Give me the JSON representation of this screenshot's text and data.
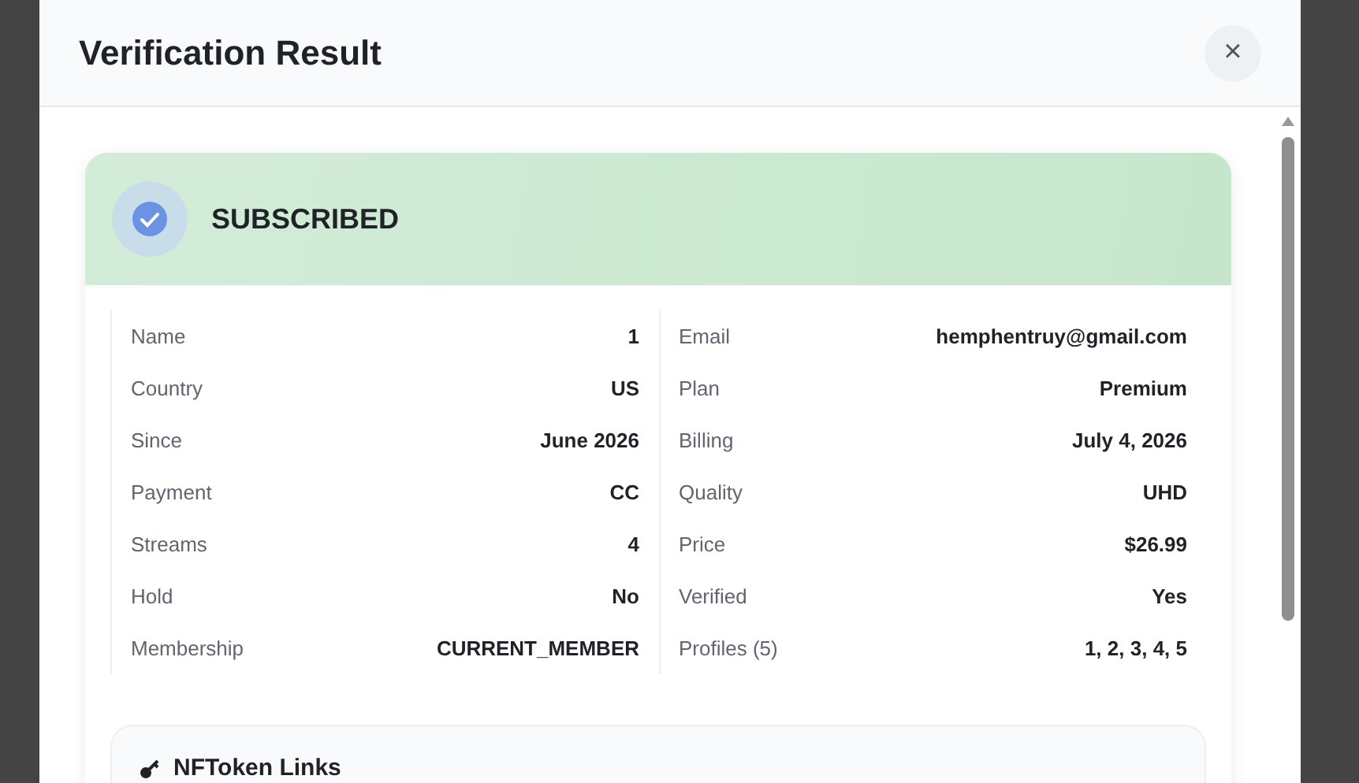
{
  "dialog": {
    "title": "Verification Result",
    "close_label": "×"
  },
  "status": {
    "kind": "success",
    "label": "SUBSCRIBED"
  },
  "details": {
    "columns": [
      [
        {
          "label": "Name",
          "value": "1"
        },
        {
          "label": "Country",
          "value": "US"
        },
        {
          "label": "Since",
          "value": "June 2026"
        },
        {
          "label": "Payment",
          "value": "CC"
        },
        {
          "label": "Streams",
          "value": "4"
        },
        {
          "label": "Hold",
          "value": "No"
        },
        {
          "label": "Membership",
          "value": "CURRENT_MEMBER"
        }
      ],
      [
        {
          "label": "Email",
          "value": "hemphentruy@gmail.com"
        },
        {
          "label": "Plan",
          "value": "Premium"
        },
        {
          "label": "Billing",
          "value": "July 4, 2026"
        },
        {
          "label": "Quality",
          "value": "UHD"
        },
        {
          "label": "Price",
          "value": "$26.99"
        },
        {
          "label": "Verified",
          "value": "Yes"
        },
        {
          "label": "Profiles (5)",
          "value": "1, 2, 3, 4, 5"
        }
      ]
    ]
  },
  "token_section": {
    "title": "NFToken Links"
  }
}
